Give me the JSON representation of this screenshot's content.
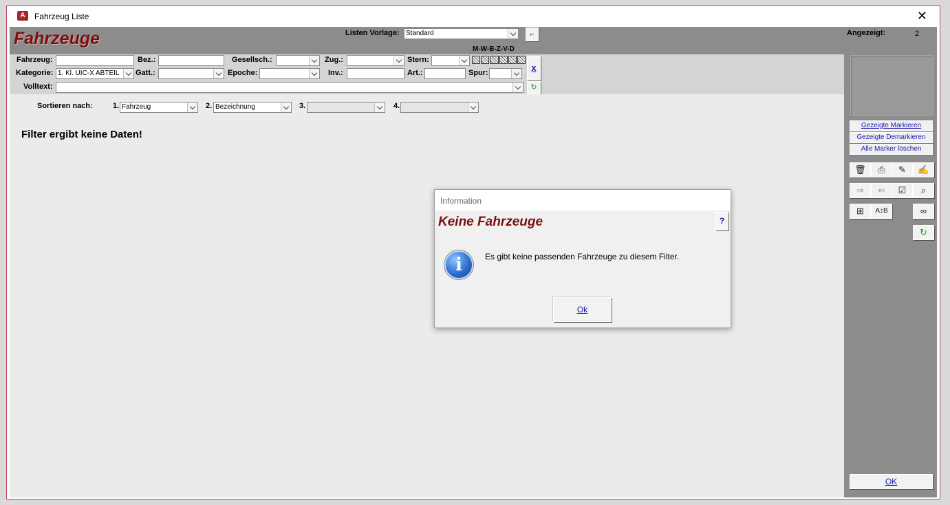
{
  "window": {
    "title": "Fahrzeug Liste",
    "app_icon_letter": "A"
  },
  "header": {
    "heading": "Fahrzeuge",
    "template_label": "Listen Vorlage:",
    "template_value": "Standard",
    "shown_label": "Angezeigt:",
    "shown_count": "2",
    "mwbzvd": "M-W-B-Z-V-D"
  },
  "filter": {
    "fahrzeug_label": "Fahrzeug:",
    "bez_label": "Bez.:",
    "gesellsch_label": "Gesellsch.:",
    "zug_label": "Zug.:",
    "stern_label": "Stern:",
    "kategorie_label": "Kategorie:",
    "kategorie_value": "1. Kl. UIC-X ABTEIL",
    "gatt_label": "Gatt.:",
    "epoche_label": "Epoche:",
    "inv_label": "Inv.:",
    "art_label": "Art.:",
    "spur_label": "Spur:",
    "volltext_label": "Volltext:",
    "clear_label": "x"
  },
  "sort": {
    "label": "Sortieren nach:",
    "n1": "1.",
    "v1": "Fahrzeug",
    "n2": "2.",
    "v2": "Bezeichnung",
    "n3": "3.",
    "v3": "",
    "n4": "4.",
    "v4": ""
  },
  "content": {
    "empty_message": "Filter ergibt keine Daten!"
  },
  "side": {
    "mark_shown": "Gezeigte Markieren",
    "unmark_shown": "Gezeigte Demarkieren",
    "clear_markers": "Alle Marker löschen",
    "ok": "OK"
  },
  "dialog": {
    "title": "Information",
    "heading": "Keine Fahrzeuge",
    "help": "?",
    "message": "Es gibt keine passenden Fahrzeuge zu diesem Filter.",
    "ok": "Ok"
  },
  "colors": {
    "brand_red": "#7b0f0f",
    "panel_gray": "#8c8c8c",
    "link_blue": "#1a1ab0"
  }
}
